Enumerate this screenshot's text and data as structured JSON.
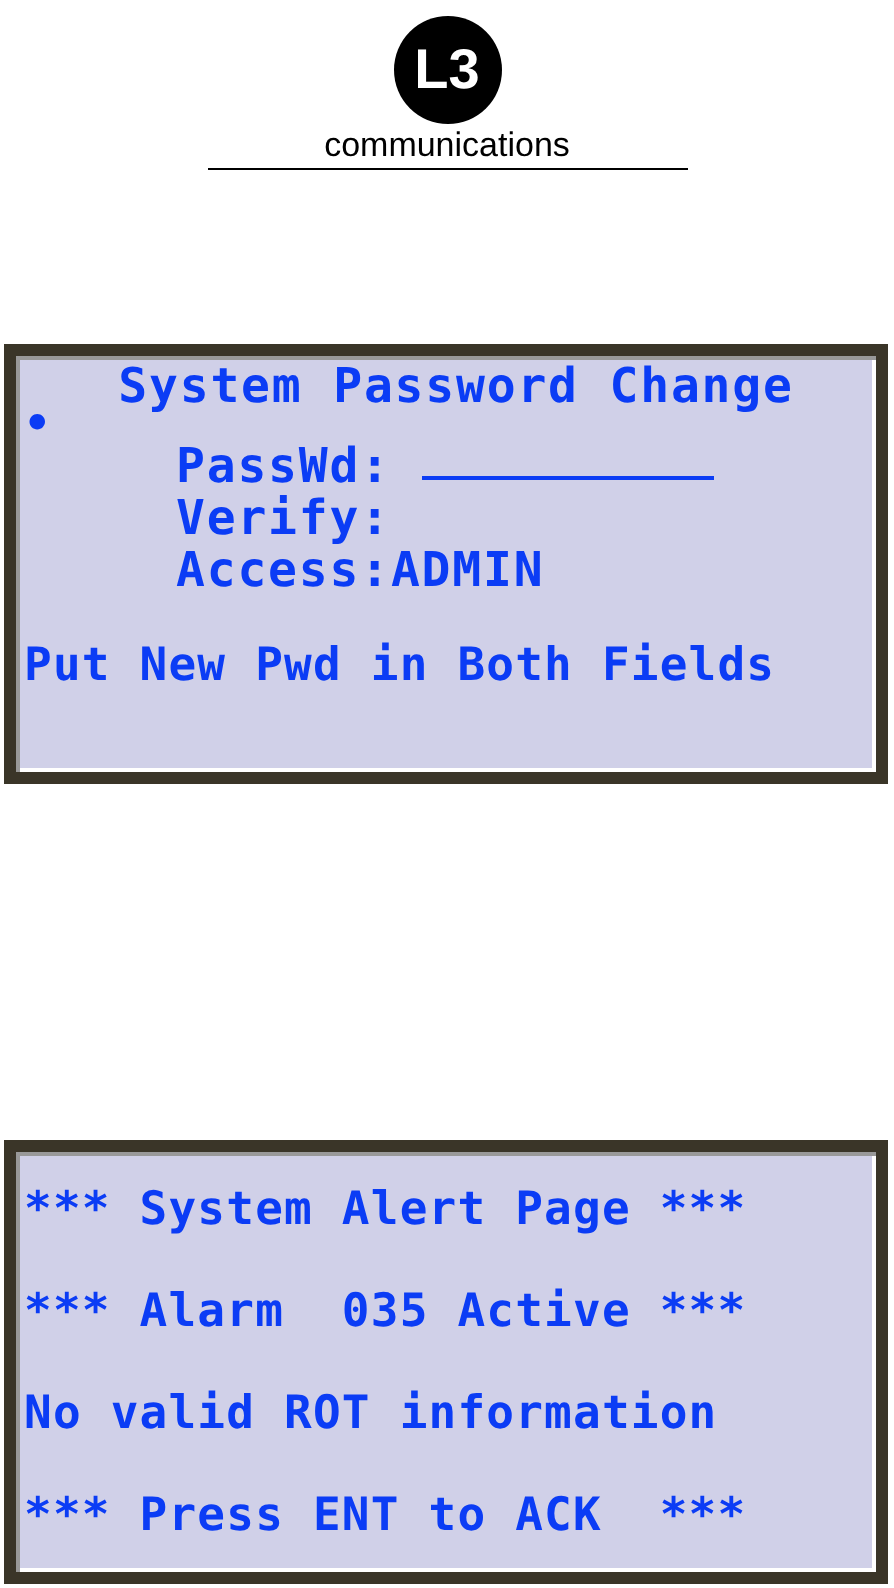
{
  "logo": {
    "mark": "L3",
    "wordmark": "communications"
  },
  "screens": [
    {
      "kind": "form",
      "title": "System Password Change",
      "cursor": "•",
      "fields": [
        {
          "label": "PassWd:",
          "kind": "input"
        },
        {
          "label": "Verify:",
          "kind": "text"
        },
        {
          "label": "Access:",
          "value": "ADMIN",
          "kind": "text"
        }
      ],
      "message": "Put New Pwd in Both Fields"
    },
    {
      "kind": "alert",
      "lines": [
        "*** System Alert Page ***",
        "*** Alarm  035 Active ***",
        "No valid ROT information",
        "*** Press ENT to ACK  ***"
      ]
    }
  ]
}
